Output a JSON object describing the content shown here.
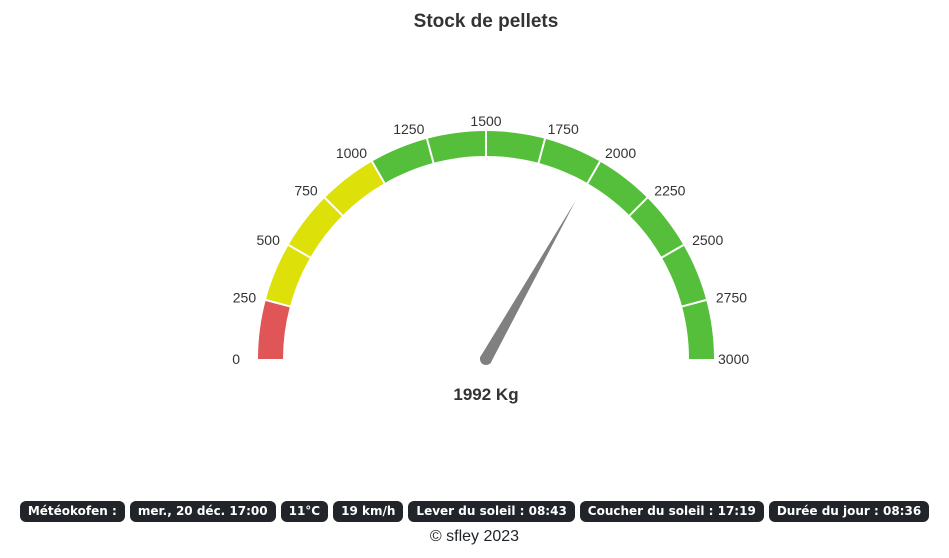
{
  "chart_data": {
    "type": "gauge",
    "title": "Stock de pellets",
    "min": 0,
    "max": 3000,
    "value": 1992,
    "value_label": "1992 Kg",
    "ticks": [
      "0",
      "250",
      "500",
      "750",
      "1000",
      "1250",
      "1500",
      "1750",
      "2000",
      "2250",
      "2500",
      "2750",
      "3000"
    ],
    "bands": [
      {
        "from": 0,
        "to": 250,
        "color": "#e05555"
      },
      {
        "from": 250,
        "to": 1000,
        "color": "#dde009"
      },
      {
        "from": 1000,
        "to": 3000,
        "color": "#55bf3b"
      }
    ],
    "needle_color": "#808080"
  },
  "info": {
    "label": "Météokofen :",
    "date": "mer., 20 déc. 17:00",
    "temperature": "11°C",
    "wind": "19 km/h",
    "sunrise": "Lever du soleil : 08:43",
    "sunset": "Coucher du soleil : 17:19",
    "day_length": "Durée du jour : 08:36"
  },
  "footer": {
    "copyright": "© sfley 2023"
  }
}
